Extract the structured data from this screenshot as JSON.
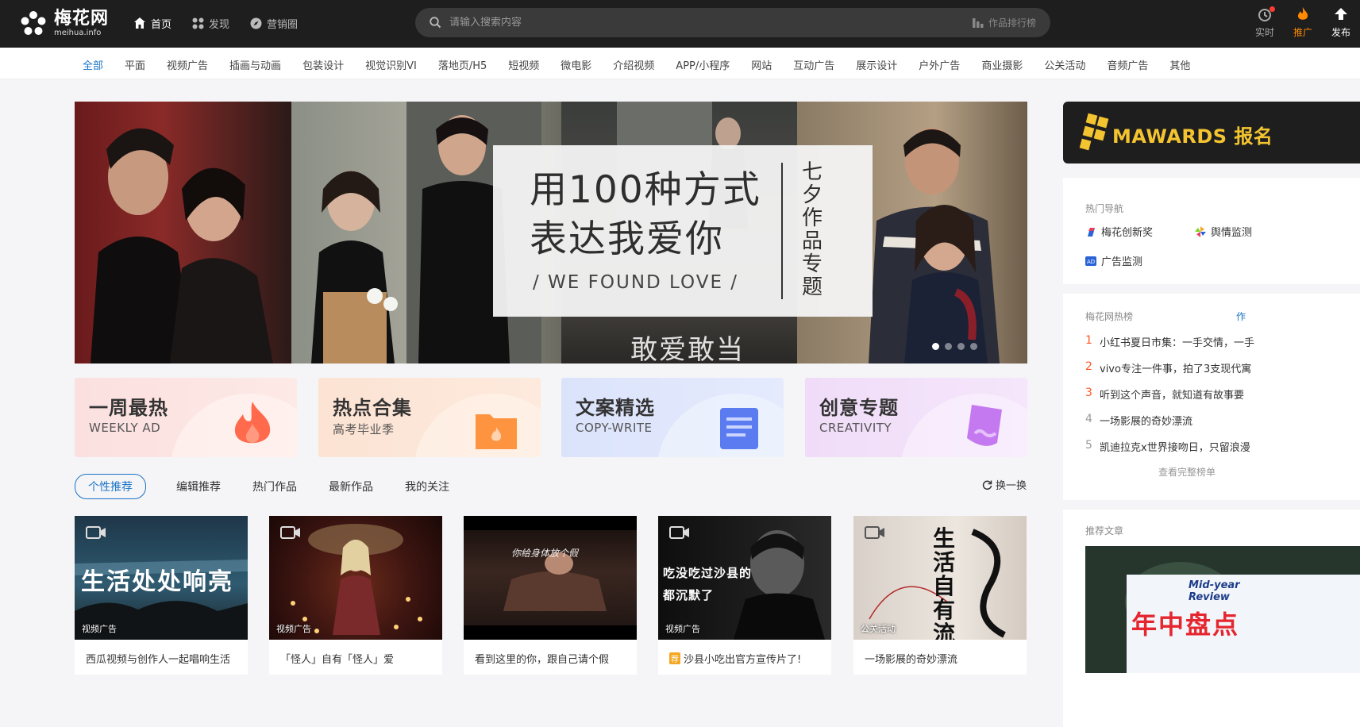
{
  "app": {
    "logo_cn": "梅花网",
    "logo_en": "meihua.info"
  },
  "nav": [
    {
      "label": "首页",
      "icon": "home-icon",
      "active": true
    },
    {
      "label": "发现",
      "icon": "grid-icon",
      "active": false
    },
    {
      "label": "营销圈",
      "icon": "compass-icon",
      "active": false
    }
  ],
  "search": {
    "placeholder": "请输入搜索内容",
    "rank_label": "作品排行榜"
  },
  "tools": [
    {
      "label": "实时",
      "icon": "realtime-icon"
    },
    {
      "label": "推广",
      "icon": "flame-icon"
    },
    {
      "label": "发布",
      "icon": "upload-icon"
    }
  ],
  "categories": [
    "全部",
    "平面",
    "视频广告",
    "插画与动画",
    "包装设计",
    "视觉识别VI",
    "落地页/H5",
    "短视频",
    "微电影",
    "介绍视频",
    "APP/小程序",
    "网站",
    "互动广告",
    "展示设计",
    "户外广告",
    "商业摄影",
    "公关活动",
    "音频广告",
    "其他"
  ],
  "banner": {
    "line1": "用100种方式",
    "line2": "表达我爱你",
    "subtitle": "/ WE FOUND LOVE /",
    "vertical": "七夕作品专题",
    "caption": "敢爱敢当",
    "slides": 4,
    "active_slide": 1
  },
  "features": [
    {
      "title": "一周最热",
      "sub": "WEEKLY AD",
      "icon": "flame-icon"
    },
    {
      "title": "热点合集",
      "sub": "高考毕业季",
      "icon": "folder-icon"
    },
    {
      "title": "文案精选",
      "sub": "COPY-WRITE",
      "icon": "document-icon"
    },
    {
      "title": "创意专题",
      "sub": "CREATIVITY",
      "icon": "tag-icon"
    }
  ],
  "tabs": [
    "个性推荐",
    "编辑推荐",
    "热门作品",
    "最新作品",
    "我的关注"
  ],
  "refresh_label": "换一换",
  "videos": [
    {
      "tag": "视频广告",
      "title": "西瓜视频与创作人一起唱响生活",
      "thumb_text": "生活处处响亮",
      "badge": ""
    },
    {
      "tag": "视频广告",
      "title": "「怪人」自有「怪人」爱",
      "thumb_text": "",
      "badge": ""
    },
    {
      "tag": "",
      "title": "看到这里的你，跟自己请个假",
      "thumb_text": "你给身体放个假",
      "badge": ""
    },
    {
      "tag": "视频广告",
      "title": "沙县小吃出官方宣传片了!",
      "thumb_text": "吃没吃过沙县的 都沉默了",
      "badge": "荐"
    },
    {
      "tag": "公关活动",
      "title": "一场影展的奇妙漂流",
      "thumb_text": "生活自有流向",
      "badge": ""
    }
  ],
  "sidebar": {
    "banner_text": "MAWARDS 报名",
    "nav_title": "热门导航",
    "nav_links": [
      {
        "label": "梅花创新奖",
        "icon": "award-icon"
      },
      {
        "label": "舆情监测",
        "icon": "pinwheel-icon"
      },
      {
        "label": "广告监测",
        "icon": "ad-icon"
      }
    ],
    "hot_title": "梅花网热榜",
    "hot_right": "作",
    "hot_items": [
      {
        "rank": "1",
        "text": "小红书夏日市集：一手交情，一手"
      },
      {
        "rank": "2",
        "text": "vivo专注一件事，拍了3支现代寓"
      },
      {
        "rank": "3",
        "text": "听到这个声音，就知道有故事要"
      },
      {
        "rank": "4",
        "text": "一场影展的奇妙漂流"
      },
      {
        "rank": "5",
        "text": "凯迪拉克x世界接吻日，只留浪漫"
      }
    ],
    "hot_more": "查看完整榜单",
    "articles_title": "推荐文章",
    "article_en": "Mid-year Review",
    "article_cn": "年中盘点"
  },
  "colors": {
    "accent": "#1a73c8",
    "topbar": "#1e1e1e",
    "promo": "#ff8a00",
    "hot_rank": "#ff5722"
  }
}
